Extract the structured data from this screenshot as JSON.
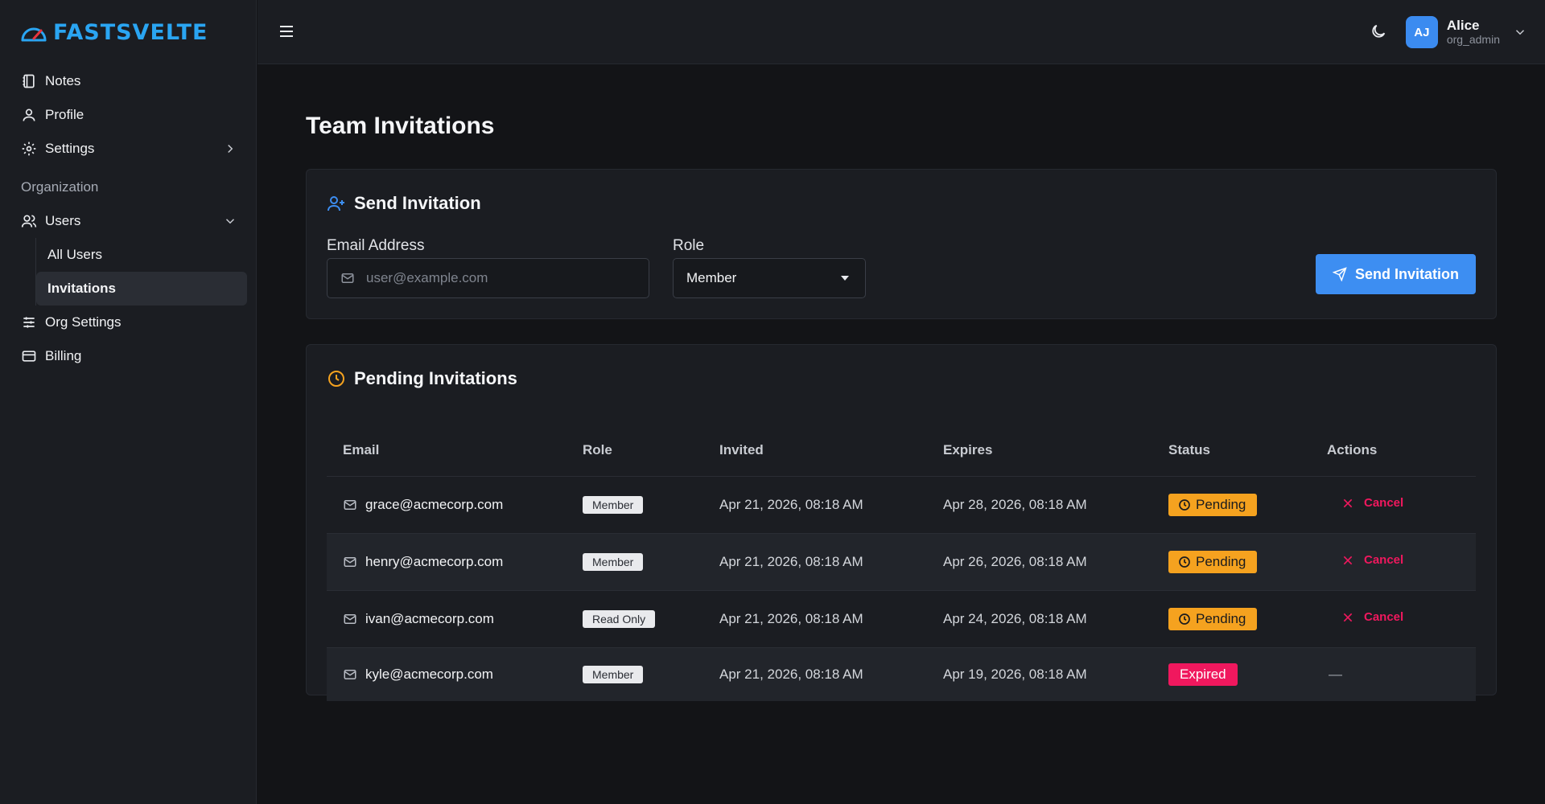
{
  "app": {
    "logo_text": "FASTSVELTE"
  },
  "sidebar": {
    "items": [
      {
        "label": "Notes",
        "icon": "notebook-icon"
      },
      {
        "label": "Profile",
        "icon": "user-icon"
      },
      {
        "label": "Settings",
        "icon": "gear-icon"
      }
    ],
    "section_label": "Organization",
    "org_items": [
      {
        "label": "Users",
        "icon": "users-icon"
      }
    ],
    "users_sub": [
      {
        "label": "All Users"
      },
      {
        "label": "Invitations",
        "active": true
      }
    ],
    "bottom_items": [
      {
        "label": "Org Settings",
        "icon": "sliders-icon"
      },
      {
        "label": "Billing",
        "icon": "credit-card-icon"
      }
    ]
  },
  "header": {
    "user": {
      "initials": "AJ",
      "name": "Alice",
      "role": "org_admin"
    }
  },
  "page": {
    "title": "Team Invitations"
  },
  "send_card": {
    "title": "Send Invitation",
    "email_label": "Email Address",
    "email_placeholder": "user@example.com",
    "role_label": "Role",
    "role_value": "Member",
    "button_label": "Send Invitation"
  },
  "pending_card": {
    "title": "Pending Invitations",
    "columns": [
      "Email",
      "Role",
      "Invited",
      "Expires",
      "Status",
      "Actions"
    ],
    "rows": [
      {
        "email": "grace@acmecorp.com",
        "role": "Member",
        "invited": "Apr 21, 2026, 08:18 AM",
        "expires": "Apr 28, 2026, 08:18 AM",
        "status": "Pending",
        "action": "Cancel"
      },
      {
        "email": "henry@acmecorp.com",
        "role": "Member",
        "invited": "Apr 21, 2026, 08:18 AM",
        "expires": "Apr 26, 2026, 08:18 AM",
        "status": "Pending",
        "action": "Cancel"
      },
      {
        "email": "ivan@acmecorp.com",
        "role": "Read Only",
        "invited": "Apr 21, 2026, 08:18 AM",
        "expires": "Apr 24, 2026, 08:18 AM",
        "status": "Pending",
        "action": "Cancel"
      },
      {
        "email": "kyle@acmecorp.com",
        "role": "Member",
        "invited": "Apr 21, 2026, 08:18 AM",
        "expires": "Apr 19, 2026, 08:18 AM",
        "status": "Expired",
        "action": "—"
      }
    ]
  },
  "colors": {
    "accent": "#3d8ef2",
    "logo": "#2aa5f2",
    "pending": "#f5a21f",
    "expired": "#f0185e",
    "danger": "#f0185e"
  }
}
